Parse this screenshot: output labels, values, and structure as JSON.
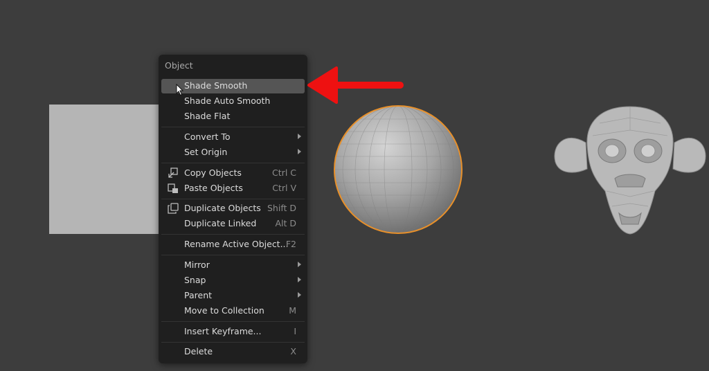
{
  "menu": {
    "title": "Object",
    "items": [
      {
        "label": "Shade Smooth",
        "shortcut": "",
        "submenu": false,
        "icon": "",
        "highlighted": true
      },
      {
        "label": "Shade Auto Smooth",
        "shortcut": "",
        "submenu": false,
        "icon": ""
      },
      {
        "label": "Shade Flat",
        "shortcut": "",
        "submenu": false,
        "icon": ""
      },
      {
        "label": "Convert To",
        "shortcut": "",
        "submenu": true,
        "icon": ""
      },
      {
        "label": "Set Origin",
        "shortcut": "",
        "submenu": true,
        "icon": ""
      },
      {
        "label": "Copy Objects",
        "shortcut": "Ctrl C",
        "submenu": false,
        "icon": "copy-icon"
      },
      {
        "label": "Paste Objects",
        "shortcut": "Ctrl V",
        "submenu": false,
        "icon": "paste-icon"
      },
      {
        "label": "Duplicate Objects",
        "shortcut": "Shift D",
        "submenu": false,
        "icon": "duplicate-icon"
      },
      {
        "label": "Duplicate Linked",
        "shortcut": "Alt D",
        "submenu": false,
        "icon": ""
      },
      {
        "label": "Rename Active Object...",
        "shortcut": "F2",
        "submenu": false,
        "icon": ""
      },
      {
        "label": "Mirror",
        "shortcut": "",
        "submenu": true,
        "icon": ""
      },
      {
        "label": "Snap",
        "shortcut": "",
        "submenu": true,
        "icon": ""
      },
      {
        "label": "Parent",
        "shortcut": "",
        "submenu": true,
        "icon": ""
      },
      {
        "label": "Move to Collection",
        "shortcut": "M",
        "submenu": false,
        "icon": ""
      },
      {
        "label": "Insert Keyframe...",
        "shortcut": "I",
        "submenu": false,
        "icon": ""
      },
      {
        "label": "Delete",
        "shortcut": "X",
        "submenu": false,
        "icon": ""
      }
    ]
  },
  "colors": {
    "background": "#3d3d3d",
    "menu_background": "#1f1f1f",
    "highlight": "#555555",
    "selection_outline": "#e8902a",
    "annotation_arrow": "#ee1111"
  }
}
